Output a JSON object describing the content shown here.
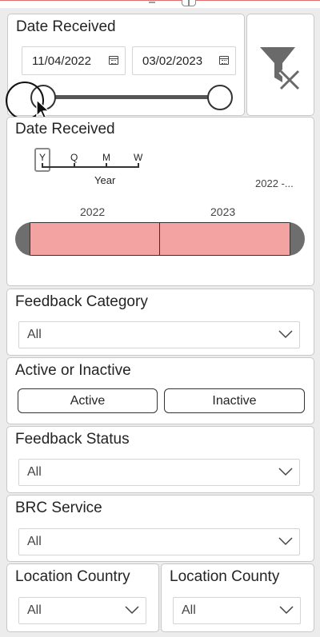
{
  "date_slicer": {
    "title": "Date Received",
    "start_date": "11/04/2022",
    "end_date": "03/02/2023",
    "start_handle_position": 0.0,
    "end_handle_position": 1.0
  },
  "clear_filters": {
    "icon": "clear-filter-icon"
  },
  "timeline": {
    "title": "Date Received",
    "granularity": {
      "options": [
        "Y",
        "Q",
        "M",
        "W"
      ],
      "selected": "Y",
      "selected_label": "Year"
    },
    "range_label": "2022 -...",
    "years": [
      "2022",
      "2023"
    ],
    "segment_color": "#f4a3a3"
  },
  "feedback_category": {
    "title": "Feedback Category",
    "value": "All"
  },
  "active_inactive": {
    "title": "Active or Inactive",
    "options": [
      "Active",
      "Inactive"
    ]
  },
  "feedback_status": {
    "title": "Feedback Status",
    "value": "All"
  },
  "brc_service": {
    "title": "BRC Service",
    "value": "All"
  },
  "location_country": {
    "title": "Location Country",
    "value": "All"
  },
  "location_county": {
    "title": "Location County",
    "value": "All"
  },
  "colors": {
    "background": "#ececec",
    "tile": "#ffffff",
    "accent_red": "#e06c6c",
    "timeline_segment": "#f4a3a3",
    "timeline_edge": "#6e6e6e"
  }
}
